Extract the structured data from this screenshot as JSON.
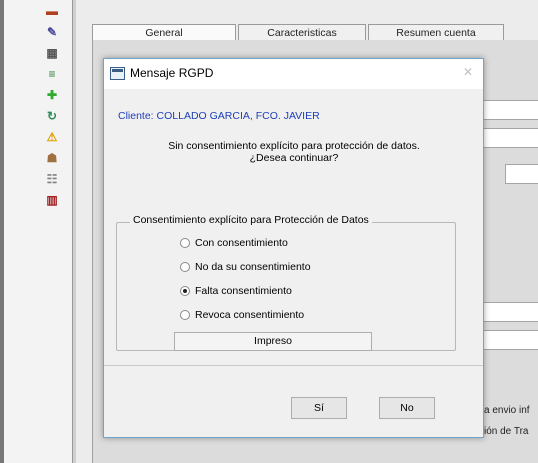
{
  "background_window": {
    "tabs": [
      {
        "label": "General"
      },
      {
        "label": "Caracteristicas"
      },
      {
        "label": "Resumen cuenta"
      }
    ],
    "partial_texts": [
      "a envio inf",
      "ión de Tra"
    ]
  },
  "toolbar": {
    "icons": [
      {
        "name": "folder-icon",
        "glyph": "▬",
        "color": "#b04020"
      },
      {
        "name": "pen-icon",
        "glyph": "✎",
        "color": "#4a4a9a"
      },
      {
        "name": "calculator-icon",
        "glyph": "▦",
        "color": "#555555"
      },
      {
        "name": "list-icon",
        "glyph": "≡",
        "color": "#2e7d32"
      },
      {
        "name": "plus-icon",
        "glyph": "✚",
        "color": "#2eaa2e"
      },
      {
        "name": "refresh-icon",
        "glyph": "↻",
        "color": "#2e8b57"
      },
      {
        "name": "warning-icon",
        "glyph": "⚠",
        "color": "#e0a000"
      },
      {
        "name": "people-icon",
        "glyph": "☗",
        "color": "#a07040"
      },
      {
        "name": "tree-icon",
        "glyph": "☷",
        "color": "#808080"
      },
      {
        "name": "books-icon",
        "glyph": "▥",
        "color": "#a02020"
      }
    ]
  },
  "dialog": {
    "title": "Mensaje RGPD",
    "client_line": "Cliente: COLLADO GARCIA, FCO. JAVIER",
    "question_line1": "Sin consentimiento explícito para protección de datos.",
    "question_line2": "¿Desea continuar?",
    "group_label": "Consentimiento explícito para Protección de Datos",
    "options": [
      {
        "label": "Con consentimiento",
        "checked": false
      },
      {
        "label": "No da su consentimiento",
        "checked": false
      },
      {
        "label": "Falta consentimiento",
        "checked": true
      },
      {
        "label": "Revoca consentimiento",
        "checked": false
      }
    ],
    "print_button": "Impreso",
    "yes_button": "Sí",
    "no_button": "No"
  }
}
